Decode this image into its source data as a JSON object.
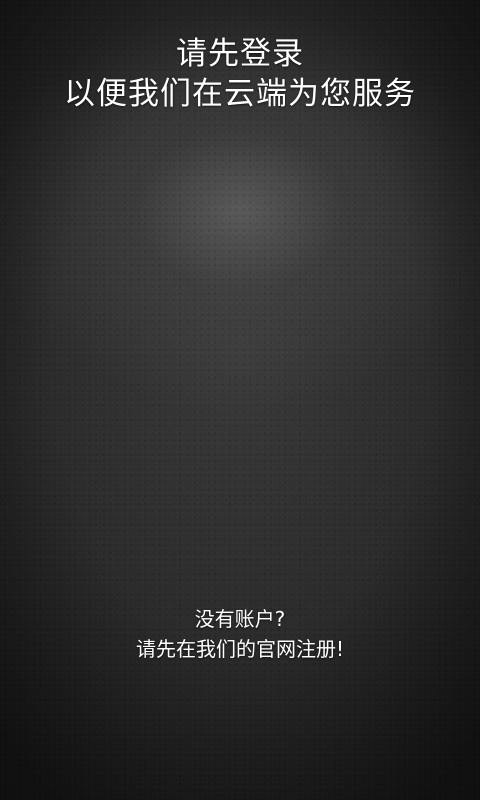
{
  "headline": {
    "line1": "请先登录",
    "line2": "以便我们在云端为您服务"
  },
  "register": {
    "question": "没有账户?",
    "prompt": "请先在我们的官网注册!"
  }
}
